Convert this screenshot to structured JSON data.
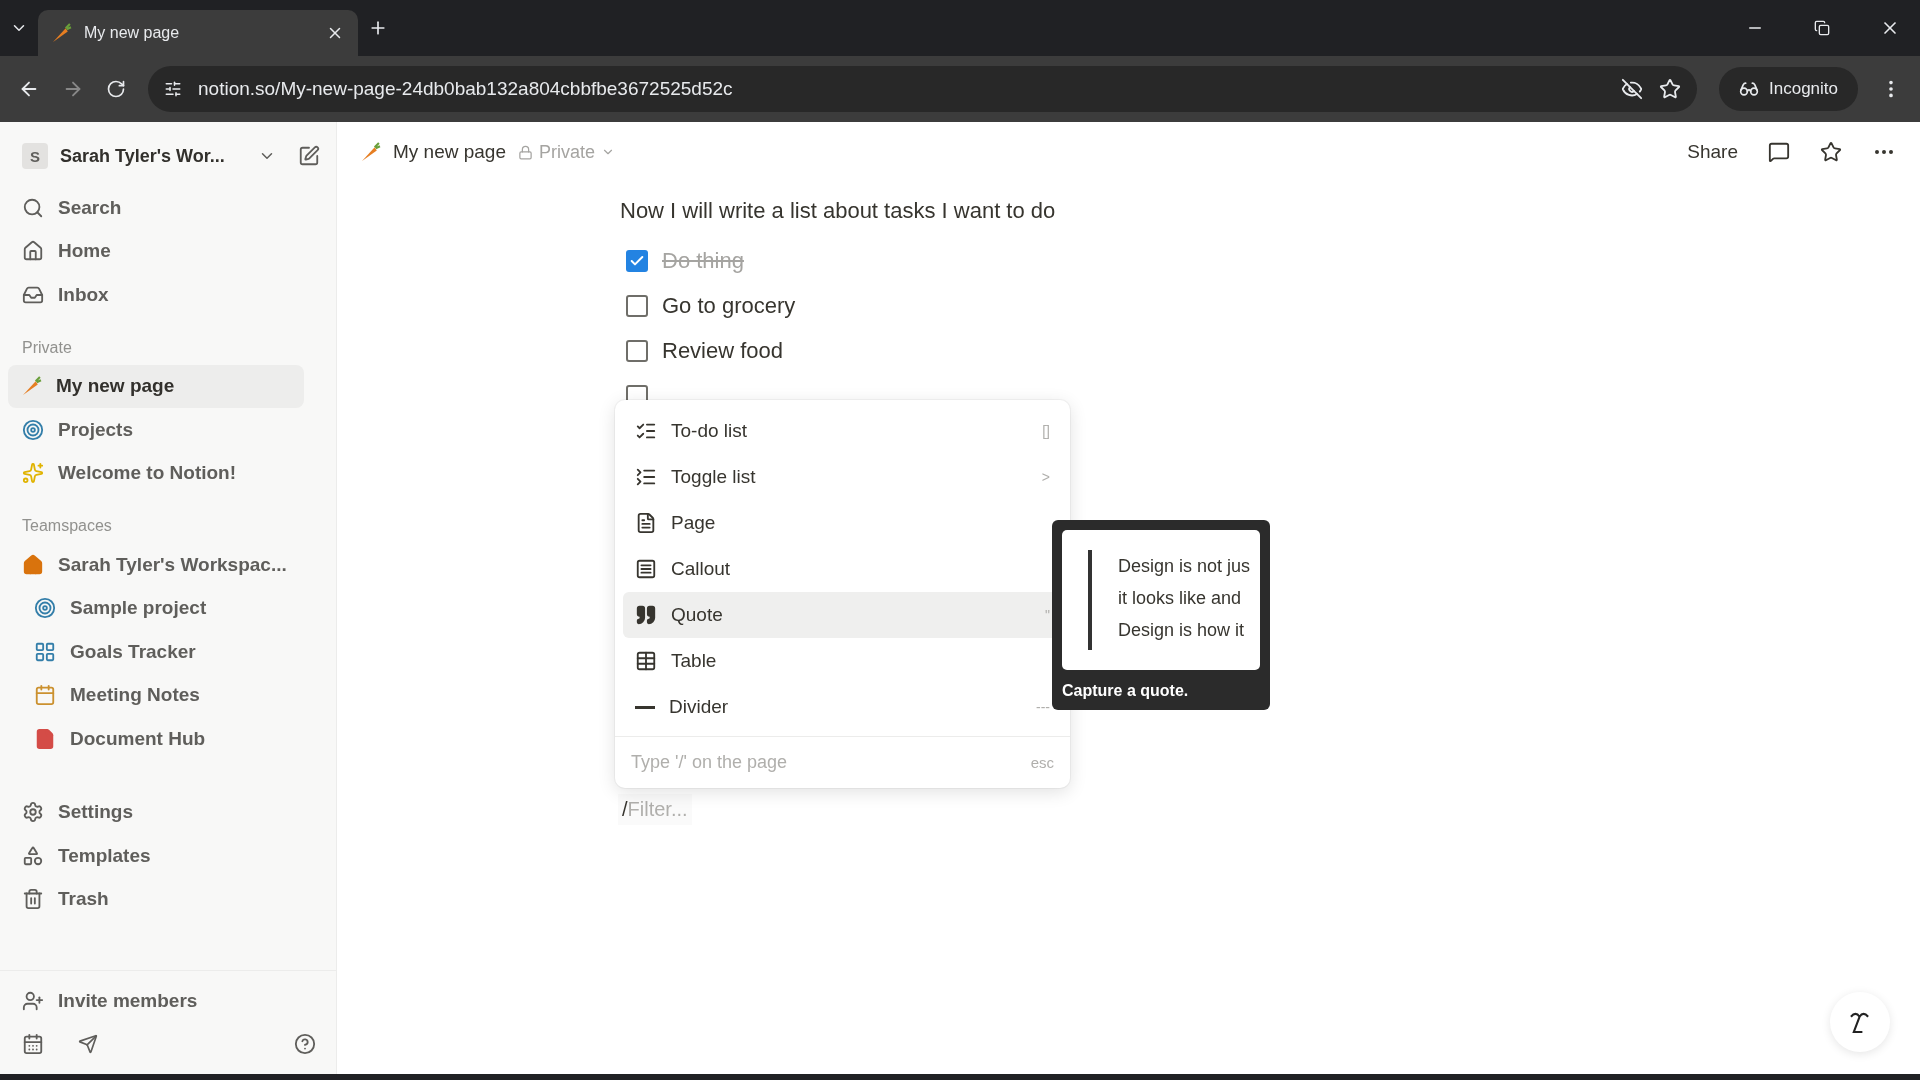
{
  "browser": {
    "tab_title": "My new page",
    "url": "notion.so/My-new-page-24db0bab132a804cbbfbe3672525d52c",
    "profile": "Incognito"
  },
  "sidebar": {
    "workspace": "Sarah Tyler's Wor...",
    "workspace_initial": "S",
    "nav": [
      "Search",
      "Home",
      "Inbox"
    ],
    "sections": [
      {
        "title": "Private",
        "items": [
          {
            "label": "My new page",
            "selected": true
          },
          {
            "label": "Projects",
            "selected": false
          },
          {
            "label": "Welcome to Notion!",
            "selected": false
          }
        ]
      },
      {
        "title": "Teamspaces",
        "items": [
          {
            "label": "Sarah Tyler's Workspac...",
            "selected": false,
            "children": [
              {
                "label": "Sample project",
                "selected": false
              },
              {
                "label": "Goals Tracker",
                "selected": false
              },
              {
                "label": "Meeting Notes",
                "selected": false
              },
              {
                "label": "Document Hub",
                "selected": false
              }
            ]
          }
        ]
      }
    ],
    "footer_nav": [
      "Settings",
      "Templates",
      "Trash"
    ],
    "invite": "Invite members"
  },
  "page": {
    "breadcrumb": "My new page",
    "privacy": "Private",
    "share": "Share",
    "paragraph": "Now I will write a list about tasks I want to do",
    "todos": [
      {
        "text": "Do thing",
        "checked": true
      },
      {
        "text": "Go to grocery",
        "checked": false
      },
      {
        "text": "Review food",
        "checked": false
      },
      {
        "checked": false
      }
    ],
    "filter_prefix": "/",
    "filter_placeholder": "Filter..."
  },
  "slash_menu": {
    "items": [
      {
        "label": "To-do list",
        "shortcut": "[]",
        "selected": false
      },
      {
        "label": "Toggle list",
        "shortcut": ">",
        "selected": false
      },
      {
        "label": "Page",
        "selected": false
      },
      {
        "label": "Callout",
        "selected": false
      },
      {
        "label": "Quote",
        "shortcut": "\"",
        "selected": true
      },
      {
        "label": "Table",
        "selected": false
      },
      {
        "label": "Divider",
        "shortcut": "---",
        "selected": false
      }
    ],
    "footer": "Type '/' on the page",
    "footer_key": "esc"
  },
  "preview": {
    "lines": [
      "Design is not jus",
      "it looks like and",
      "Design is how it"
    ],
    "caption": "Capture a quote."
  }
}
